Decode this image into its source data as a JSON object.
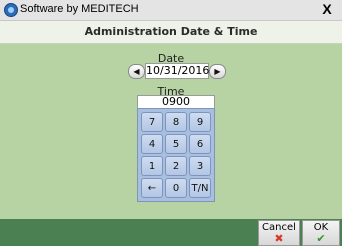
{
  "window": {
    "title": "Software by MEDITECH",
    "close_label": "X"
  },
  "dialog": {
    "title": "Administration Date & Time"
  },
  "date": {
    "label": "Date",
    "value": "10/31/2016",
    "prev_label": "◀",
    "next_label": "▶"
  },
  "time": {
    "label": "Time",
    "value": "0900"
  },
  "keypad": {
    "rows": [
      [
        "7",
        "8",
        "9"
      ],
      [
        "4",
        "5",
        "6"
      ],
      [
        "1",
        "2",
        "3"
      ],
      [
        "←",
        "0",
        "T/N"
      ]
    ]
  },
  "footer": {
    "cancel_label": "Cancel",
    "ok_label": "OK",
    "cancel_icon": "✖",
    "ok_icon": "✔",
    "cancel_icon_color": "#d43a2c",
    "ok_icon_color": "#2f9a2a"
  },
  "colors": {
    "body_bg": "#b7d3a4",
    "footer_bg": "#4b8152",
    "keypad_bg": "#a8bfe0"
  }
}
